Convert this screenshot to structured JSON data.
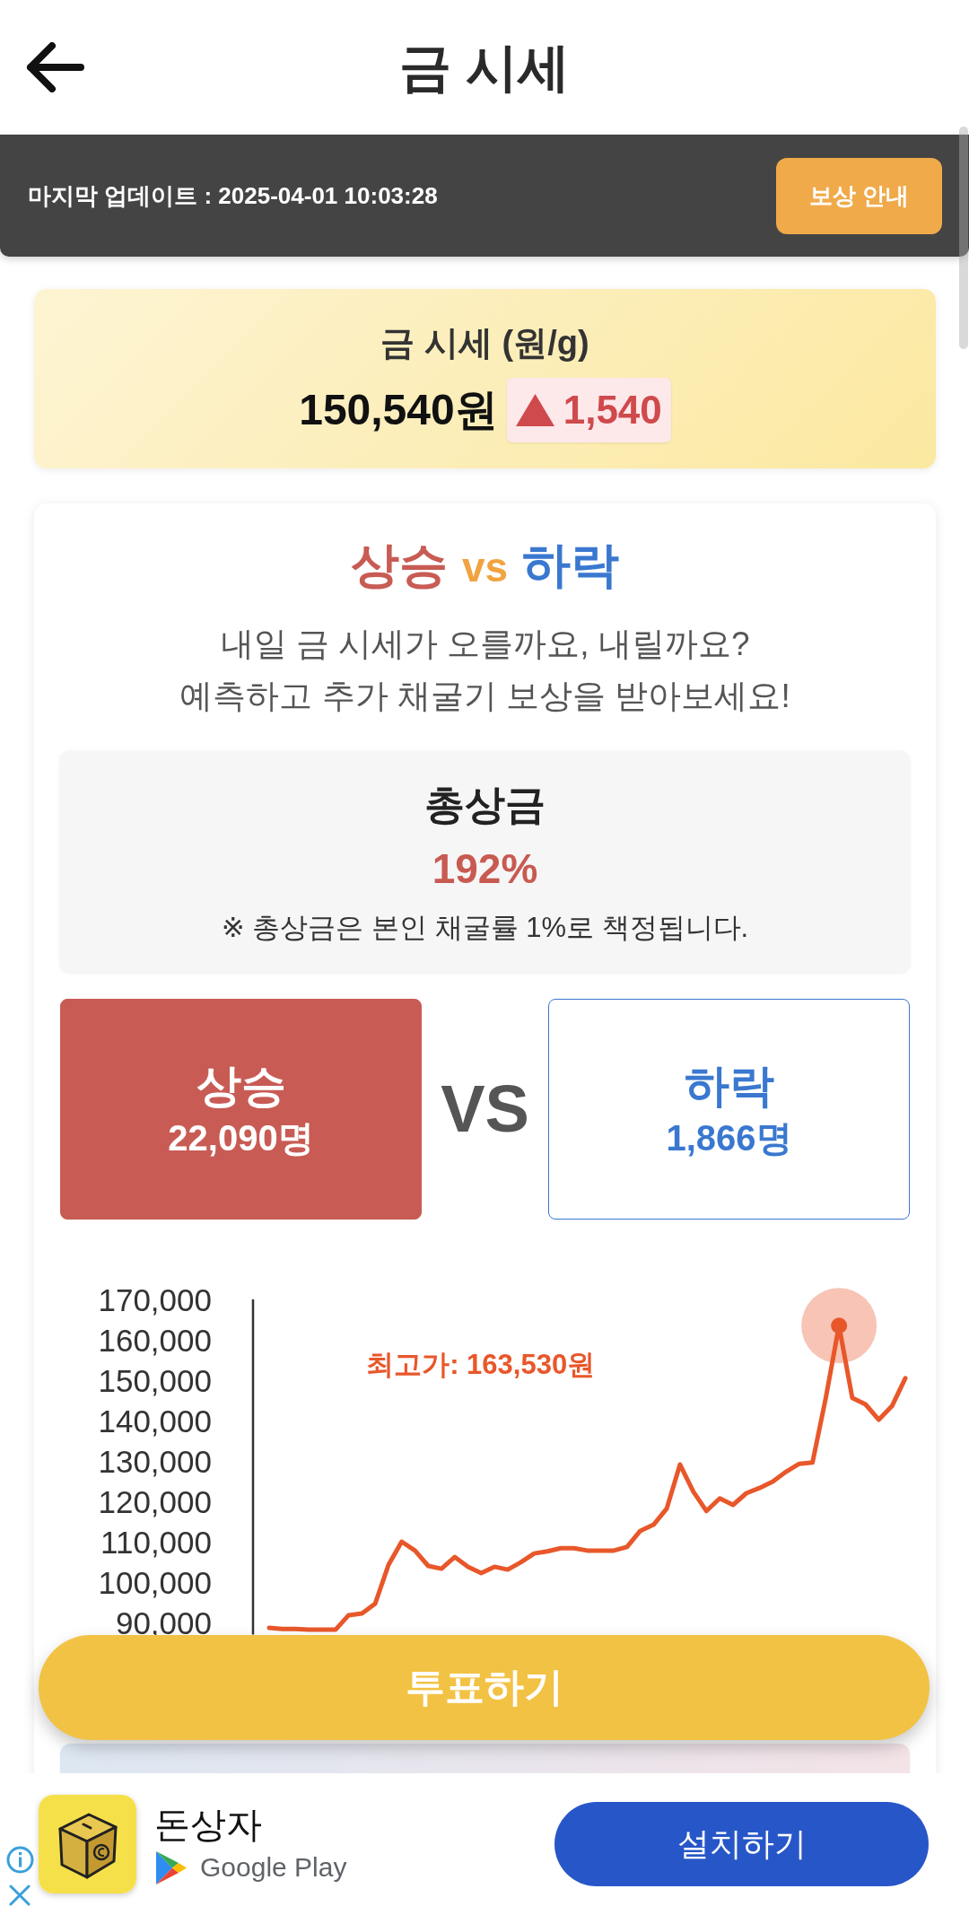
{
  "header": {
    "title": "금 시세"
  },
  "update_bar": {
    "text": "마지막 업데이트 : 2025-04-01 10:03:28",
    "button": "보상 안내"
  },
  "price_card": {
    "title": "금 시세 (원/g)",
    "price": "150,540원",
    "change": {
      "rising": true,
      "value": "1,540"
    }
  },
  "prediction": {
    "title": [
      {
        "text": "상승",
        "kind": "up"
      },
      {
        "text": "vs",
        "kind": "vs"
      },
      {
        "text": "하락",
        "kind": "down"
      }
    ],
    "subtitle": [
      "내일 금 시세가 오를까요, 내릴까요?",
      "예측하고 추가 채굴기 보상을 받아보세요!"
    ],
    "prize": {
      "label": "총상금",
      "value": "192%",
      "note": "※ 총상금은 본인 채굴률 1%로 책정됩니다."
    },
    "options": [
      {
        "label": "상승",
        "count": "22,090명",
        "kind": "up",
        "selected": true
      },
      {
        "label": "하락",
        "count": "1,866명",
        "kind": "down",
        "selected": false
      }
    ],
    "vs_label": "VS",
    "chart_data": {
      "type": "line",
      "ylim": [
        87000,
        170000
      ],
      "yticks": [
        {
          "value": 170000,
          "label": "170,000"
        },
        {
          "value": 160000,
          "label": "160,000"
        },
        {
          "value": 150000,
          "label": "150,000"
        },
        {
          "value": 140000,
          "label": "140,000"
        },
        {
          "value": 130000,
          "label": "130,000"
        },
        {
          "value": 120000,
          "label": "120,000"
        },
        {
          "value": 110000,
          "label": "110,000"
        },
        {
          "value": 100000,
          "label": "100,000"
        },
        {
          "value": 90000,
          "label": "90,000"
        }
      ],
      "series": [
        {
          "color": "#e8572a",
          "values": [
            88700,
            88400,
            88400,
            88200,
            88200,
            88200,
            91800,
            92200,
            94700,
            104200,
            110000,
            107800,
            104000,
            103300,
            106200,
            103800,
            102200,
            103800,
            103100,
            104900,
            107100,
            107600,
            108400,
            108400,
            107800,
            107800,
            107800,
            108700,
            112700,
            114200,
            118200,
            129100,
            122400,
            117600,
            120700,
            119100,
            122000,
            123300,
            124900,
            127300,
            129300,
            129600,
            145600,
            163500,
            145600,
            144000,
            140200,
            143600,
            150500
          ]
        }
      ],
      "annotations": [
        "최고가: 163,530원"
      ]
    }
  },
  "vote_button": "투표하기",
  "ad": {
    "app_name": "돈상자",
    "store": "Google Play",
    "button": "설치하기"
  }
}
